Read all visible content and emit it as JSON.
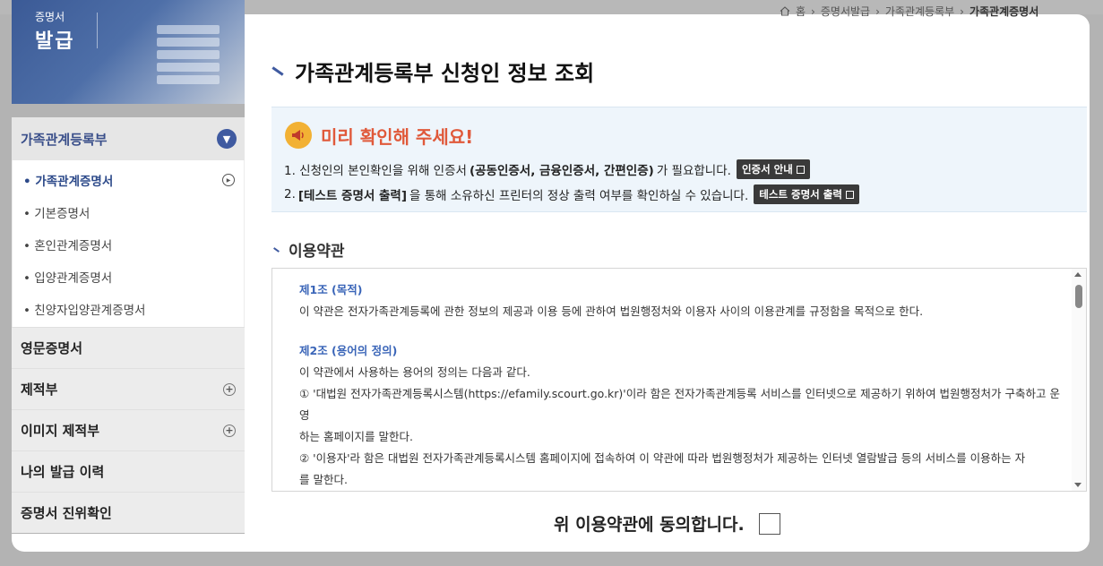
{
  "banner": {
    "title_small": "증명서",
    "title_big": "발급"
  },
  "breadcrumb": {
    "home": "홈",
    "level1": "증명서발급",
    "level2": "가족관계등록부",
    "current": "가족관계증명서"
  },
  "sidebar": {
    "header": "가족관계등록부",
    "sub_items": [
      {
        "label": "• 가족관계증명서",
        "active": true
      },
      {
        "label": "• 기본증명서"
      },
      {
        "label": "• 혼인관계증명서"
      },
      {
        "label": "• 입양관계증명서"
      },
      {
        "label": "• 친양자입양관계증명서"
      }
    ],
    "menu": [
      {
        "label": "영문증명서",
        "expandable": false
      },
      {
        "label": "제적부",
        "expandable": true
      },
      {
        "label": "이미지 제적부",
        "expandable": true
      },
      {
        "label": "나의 발급 이력",
        "expandable": false
      },
      {
        "label": "증명서 진위확인",
        "expandable": false
      }
    ]
  },
  "page": {
    "title": "가족관계등록부 신청인 정보 조회"
  },
  "notice": {
    "heading": "미리 확인해 주세요!",
    "line1_pre": "1. 신청인의 본인확인을 위해 인증서",
    "line1_bold": "(공동인증서, 금융인증서, 간편인증)",
    "line1_post": "가 필요합니다.",
    "line1_button": "인증서 안내",
    "line2_pre": "2. ",
    "line2_bold": "[테스트 증명서 출력]",
    "line2_post": "을 통해 소유하신 프린터의 정상 출력 여부를 확인하실 수 있습니다.",
    "line2_button": "테스트 증명서 출력"
  },
  "terms": {
    "section_title": "이용약관",
    "art1_title": "제1조 (목적)",
    "art1_text": "이 약관은 전자가족관계등록에 관한 정보의 제공과 이용 등에 관하여 법원행정처와 이용자 사이의 이용관계를 규정함을 목적으로 한다.",
    "art2_title": "제2조 (용어의 정의)",
    "art2_intro": "이 약관에서 사용하는 용어의 정의는 다음과 같다.",
    "art2_item1a": "① '대법원 전자가족관계등록시스템(https://efamily.scourt.go.kr)'이라 함은 전자가족관계등록 서비스를 인터넷으로 제공하기 위하여 법원행정처가 구축하고 운영",
    "art2_item1b": "하는 홈페이지를 말한다.",
    "art2_item2a": "② '이용자'라 함은 대법원 전자가족관계등록시스템 홈페이지에 접속하여 이 약관에 따라 법원행정처가 제공하는 인터넷 열람발급 등의 서비스를 이용하는 자",
    "art2_item2b": "를 말한다."
  },
  "agree": {
    "label": "위 이용약관에 동의합니다.",
    "checked": false
  },
  "colors": {
    "accent": "#3f5aa0",
    "notice_heading": "#e0593a",
    "link_blue": "#3a65b8"
  }
}
